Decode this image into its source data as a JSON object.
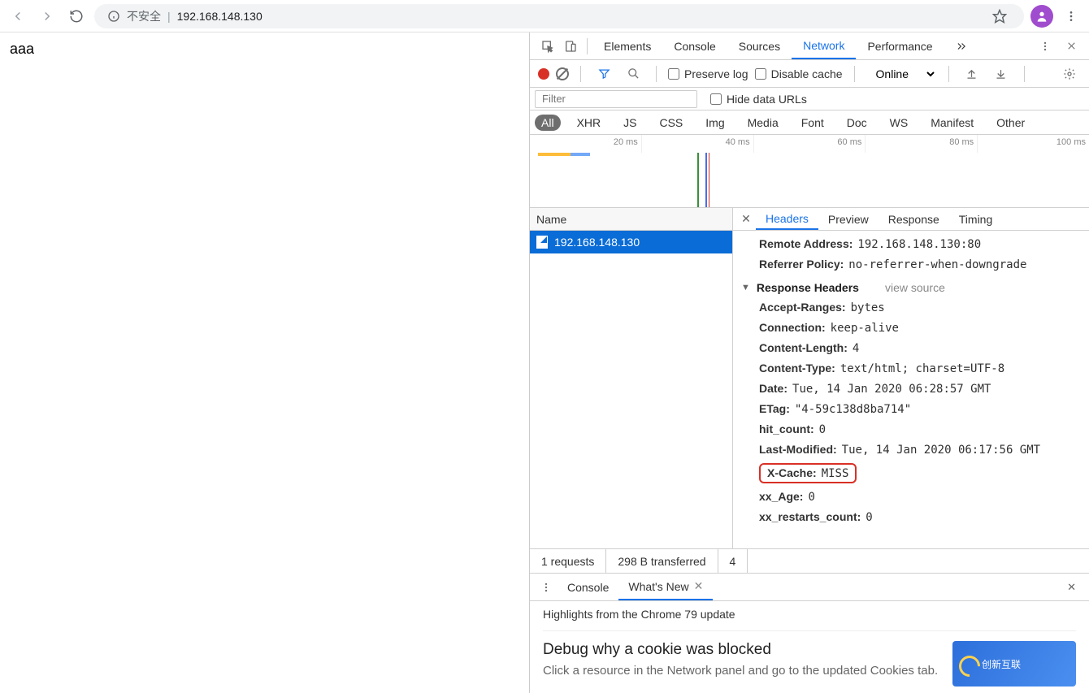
{
  "browser": {
    "security_label": "不安全",
    "url": "192.168.148.130"
  },
  "page": {
    "content": "aaa"
  },
  "devtools": {
    "tabs": [
      "Elements",
      "Console",
      "Sources",
      "Network",
      "Performance"
    ],
    "active_tab": "Network",
    "preserve_log": "Preserve log",
    "disable_cache": "Disable cache",
    "throttle": "Online",
    "filter_placeholder": "Filter",
    "hide_urls": "Hide data URLs",
    "type_filters": [
      "All",
      "XHR",
      "JS",
      "CSS",
      "Img",
      "Media",
      "Font",
      "Doc",
      "WS",
      "Manifest",
      "Other"
    ],
    "timeline_ticks": [
      "20 ms",
      "40 ms",
      "60 ms",
      "80 ms",
      "100 ms"
    ],
    "name_col": "Name",
    "request_name": "192.168.148.130",
    "detail_tabs": [
      "Headers",
      "Preview",
      "Response",
      "Timing"
    ],
    "general": {
      "remote_addr_k": "Remote Address:",
      "remote_addr_v": "192.168.148.130:80",
      "ref_policy_k": "Referrer Policy:",
      "ref_policy_v": "no-referrer-when-downgrade"
    },
    "resp_section": "Response Headers",
    "view_source": "view source",
    "resp_headers": [
      {
        "k": "Accept-Ranges:",
        "v": "bytes"
      },
      {
        "k": "Connection:",
        "v": "keep-alive"
      },
      {
        "k": "Content-Length:",
        "v": "4"
      },
      {
        "k": "Content-Type:",
        "v": "text/html; charset=UTF-8"
      },
      {
        "k": "Date:",
        "v": "Tue, 14 Jan 2020 06:28:57 GMT"
      },
      {
        "k": "ETag:",
        "v": "\"4-59c138d8ba714\""
      },
      {
        "k": "hit_count:",
        "v": "0"
      },
      {
        "k": "Last-Modified:",
        "v": "Tue, 14 Jan 2020 06:17:56 GMT"
      },
      {
        "k": "X-Cache:",
        "v": "MISS"
      },
      {
        "k": "xx_Age:",
        "v": "0"
      },
      {
        "k": "xx_restarts_count:",
        "v": "0"
      }
    ],
    "status": {
      "requests": "1 requests",
      "transferred": "298 B transferred",
      "more": "4"
    },
    "drawer": {
      "tabs": [
        "Console",
        "What's New"
      ],
      "highlight": "Highlights from the Chrome 79 update",
      "h": "Debug why a cookie was blocked",
      "p": "Click a resource in the Network panel and go to the updated Cookies tab.",
      "img_text": "创新互联"
    }
  }
}
